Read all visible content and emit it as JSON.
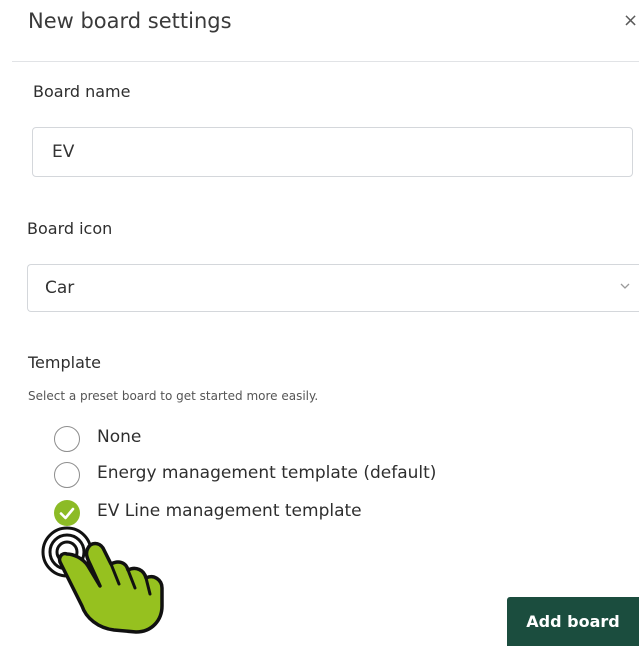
{
  "dialog": {
    "title": "New board settings",
    "close_symbol": "×",
    "close_icon": "close-icon"
  },
  "board_name": {
    "label": "Board name",
    "value": "EV"
  },
  "board_icon": {
    "label": "Board icon",
    "selected": "Car",
    "chevron_icon": "chevron-down-icon"
  },
  "template": {
    "label": "Template",
    "help": "Select a preset board to get started more easily.",
    "options": [
      {
        "label": "None",
        "checked": false
      },
      {
        "label": "Energy management template (default)",
        "checked": false
      },
      {
        "label": "EV Line management template",
        "checked": true
      }
    ]
  },
  "actions": {
    "add_board_label": "Add board"
  },
  "overlay": {
    "icon": "pointing-hand-icon"
  },
  "colors": {
    "accent_green": "#8cbb26",
    "button_dark_green": "#1b4d3e",
    "border": "#d4d7db"
  }
}
